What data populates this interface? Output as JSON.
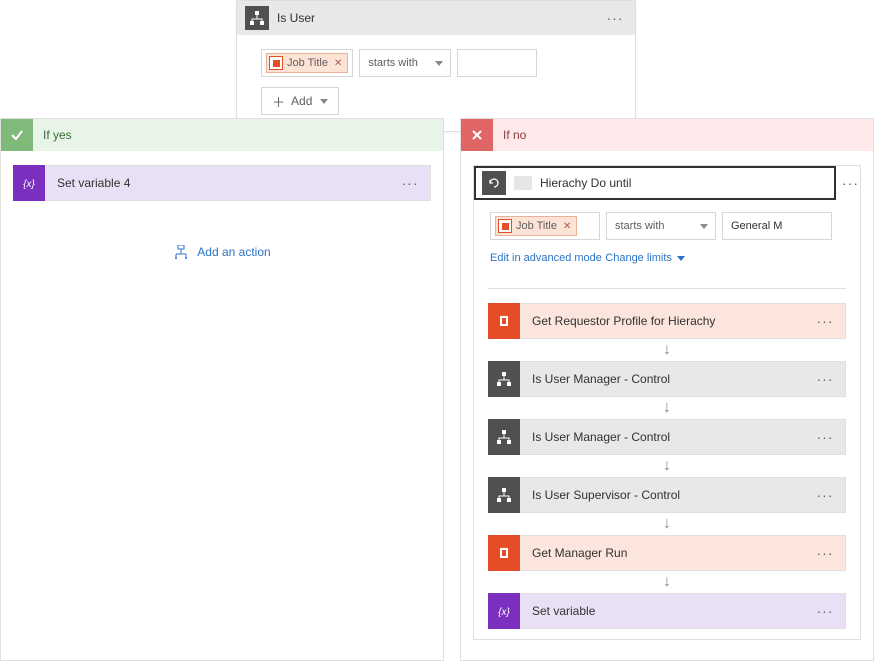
{
  "topCondition": {
    "title": "Is User",
    "tokenLabel": "Job Title",
    "operator": "starts with",
    "value": "",
    "addLabel": "Add"
  },
  "yesBranch": {
    "label": "If yes",
    "step1": "Set variable 4",
    "addAction": "Add an action"
  },
  "noBranch": {
    "label": "If no",
    "doUntil": {
      "title": "Hierachy Do until",
      "tokenLabel": "Job Title",
      "operator": "starts with",
      "value": "General M",
      "editAdvanced": "Edit in advanced mode",
      "changeLimits": "Change limits"
    },
    "steps": {
      "s1": "Get Requestor Profile for Hierachy",
      "s2": "Is User        Manager - Control",
      "s3": "Is User Manager - Control",
      "s4": "Is User Supervisor - Control",
      "s5": "Get Manager      Run",
      "s6": "Set variable"
    }
  }
}
